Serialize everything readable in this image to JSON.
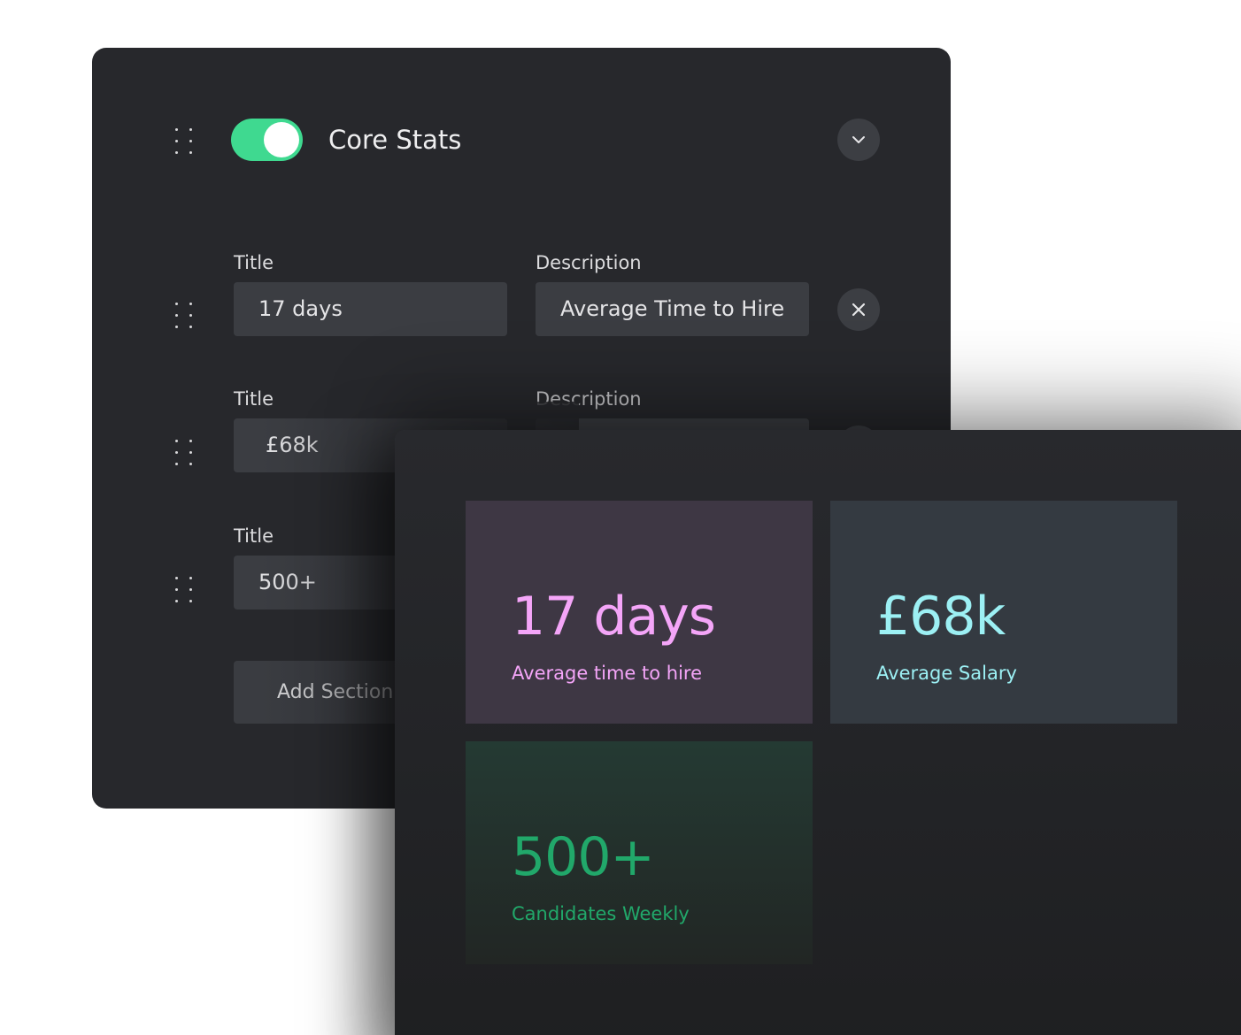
{
  "editor": {
    "section_title": "Core Stats",
    "toggle_on": true,
    "rows": [
      {
        "title_label": "Title",
        "title_value": "17 days",
        "description_label": "Description",
        "description_value": "Average Time to Hire"
      },
      {
        "title_label": "Title",
        "title_value": "£68k",
        "description_label": "Description"
      },
      {
        "title_label": "Title",
        "title_value": "500+"
      }
    ],
    "add_section_label": "Add Section"
  },
  "preview": {
    "cards": [
      {
        "value": "17 days",
        "caption": "Average time to hire",
        "color": "#f4a5f8"
      },
      {
        "value": "£68k",
        "caption": "Average Salary",
        "color": "#9cf0f4"
      },
      {
        "value": "500+",
        "caption": "Candidates Weekly",
        "color": "#21a86a"
      }
    ]
  },
  "colors": {
    "toggle": "#3fd990",
    "panel": "#27282c",
    "input": "#3b3d42"
  },
  "icons": [
    "drag-handle-icon",
    "chevron-down-icon",
    "close-icon"
  ]
}
